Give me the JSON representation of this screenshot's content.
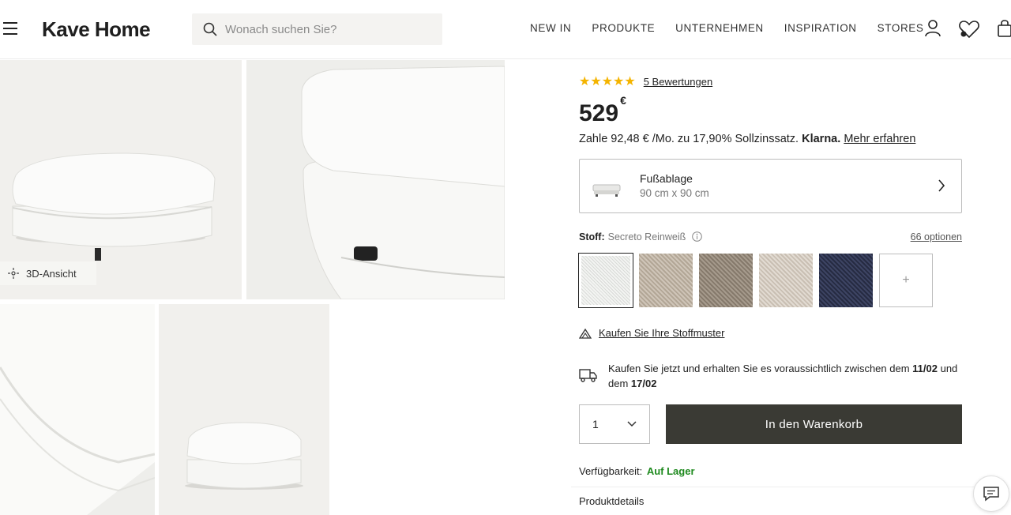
{
  "header": {
    "logo": "Kave Home",
    "search_placeholder": "Wonach suchen Sie?",
    "nav": [
      "NEW IN",
      "PRODUKTE",
      "UNTERNEHMEN",
      "INSPIRATION",
      "STORES"
    ],
    "icons": [
      "menu-icon",
      "search-icon",
      "user-icon",
      "wishlist-icon",
      "bag-icon"
    ]
  },
  "gallery": {
    "badge_3d": "3D-Ansicht",
    "images": [
      "ottoman-front",
      "ottoman-corner-closeup",
      "cushion-edge-closeup",
      "ottoman-small"
    ]
  },
  "product": {
    "rating_stars": 5,
    "reviews_link": "5 Bewertungen",
    "price": "529",
    "currency": "€",
    "financing_text": "Zahle 92,48 € /Mo. zu 17,90% Sollzinssatz.",
    "financing_brand": "Klarna.",
    "financing_link": "Mehr erfahren",
    "variant": {
      "title": "Fußablage",
      "dimensions": "90 cm x 90 cm"
    },
    "fabric": {
      "label": "Stoff:",
      "value": "Secreto Reinweiß",
      "options_link": "66 optionen",
      "more_symbol": "+"
    },
    "swatch_colors": [
      "#e9eae8",
      "#c7bcae",
      "#9d9284",
      "#d8d0c6",
      "#363c58"
    ],
    "sample_link": "Kaufen Sie Ihre Stoffmuster",
    "delivery_text_a": "Kaufen Sie jetzt und erhalten Sie es voraussichtlich zwischen dem ",
    "delivery_date_from": "11/02",
    "delivery_text_b": " und dem ",
    "delivery_date_to": "17/02",
    "quantity": "1",
    "cart_button": "In den Warenkorb",
    "availability_label": "Verfügbarkeit:",
    "availability_value": "Auf Lager",
    "details_heading": "Produktdetails"
  },
  "colors": {
    "cart_button_bg": "#3a3a34",
    "star": "#f4b400",
    "in_stock": "#1f8a1f"
  }
}
